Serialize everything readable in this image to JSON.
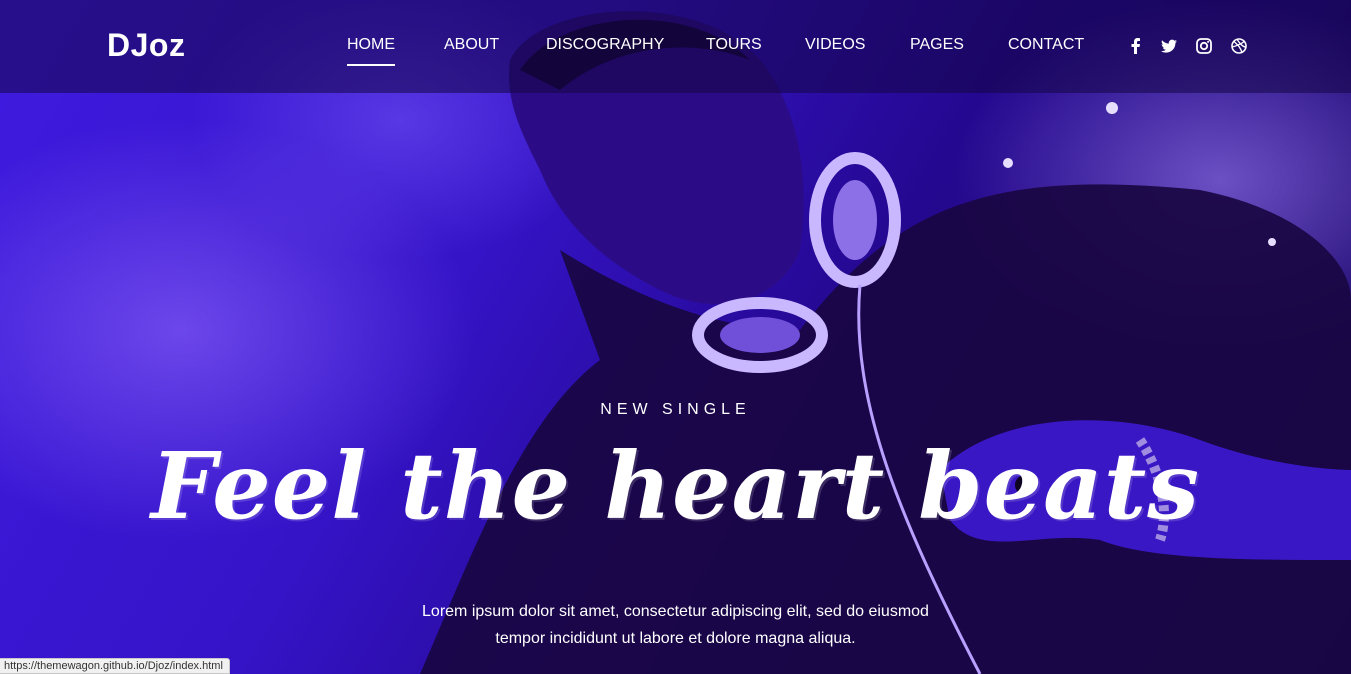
{
  "brand": {
    "logo": "DJoz"
  },
  "nav": {
    "items": [
      {
        "label": "HOME",
        "active": true
      },
      {
        "label": "ABOUT",
        "active": false
      },
      {
        "label": "DISCOGRAPHY",
        "active": false
      },
      {
        "label": "TOURS",
        "active": false
      },
      {
        "label": "VIDEOS",
        "active": false
      },
      {
        "label": "PAGES",
        "active": false
      },
      {
        "label": "CONTACT",
        "active": false
      }
    ]
  },
  "social": [
    "facebook-icon",
    "twitter-icon",
    "instagram-icon",
    "dribbble-icon"
  ],
  "hero": {
    "kicker": "NEW SINGLE",
    "headline": "Feel the heart beats",
    "description": "Lorem ipsum dolor sit amet, consectetur adipiscing elit, sed do eiusmod tempor incididunt ut labore et dolore magna aliqua."
  },
  "status_bar": {
    "url": "https://themewagon.github.io/Djoz/index.html"
  },
  "colors": {
    "overlay": "#3514c8",
    "text": "#ffffff"
  }
}
